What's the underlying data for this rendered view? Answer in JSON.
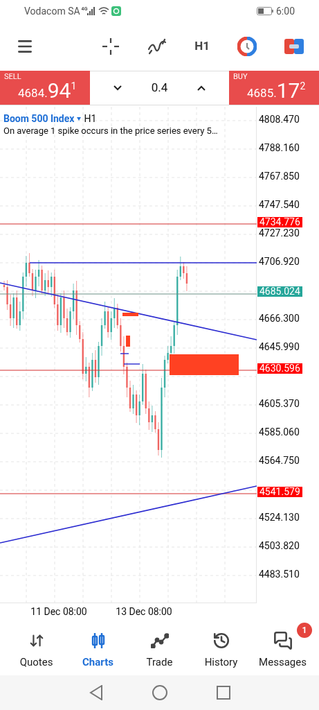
{
  "status_bar": {
    "carrier": "Vodacom SA",
    "network": "4G",
    "time": "6:00"
  },
  "toolbar": {
    "timeframe": "H1"
  },
  "trade_panel": {
    "sell": {
      "label": "SELL",
      "price_main": "4684.",
      "price_big": "94",
      "price_sup": "1"
    },
    "lot": "0.4",
    "buy": {
      "label": "BUY",
      "price_main": "4685.",
      "price_big": "17",
      "price_sup": "2"
    }
  },
  "chart": {
    "symbol": "Boom 500 Index",
    "timeframe": "H1",
    "description": "On average 1 spike occurs in the price series every 5…",
    "price_axis": [
      "4808.470",
      "4788.160",
      "4767.850",
      "4747.540",
      "4727.230",
      "4706.920",
      "4666.300",
      "4645.990",
      "4605.370",
      "4585.060",
      "4564.750",
      "4524.130",
      "4503.820",
      "4483.510"
    ],
    "price_tags": [
      {
        "label": "4734.776",
        "color": "#ff0000"
      },
      {
        "label": "4685.024",
        "color": "#26a69a"
      },
      {
        "label": "4630.596",
        "color": "#ff0000"
      },
      {
        "label": "4541.579",
        "color": "#ff0000"
      }
    ],
    "time_axis": [
      "11 Dec 08:00",
      "13 Dec 08:00"
    ]
  },
  "bottom_nav": [
    {
      "label": "Quotes",
      "selected": false
    },
    {
      "label": "Charts",
      "selected": true
    },
    {
      "label": "Trade",
      "selected": false
    },
    {
      "label": "History",
      "selected": false
    },
    {
      "label": "Messages",
      "selected": false,
      "badge": "1"
    }
  ]
}
